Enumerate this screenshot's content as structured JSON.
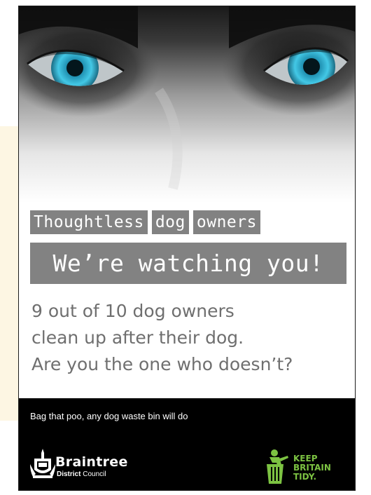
{
  "poster": {
    "tagline_words": [
      "Thoughtless",
      "dog",
      "owners"
    ],
    "headline": "We’re watching you!",
    "stat_lines": [
      "9 out of 10 dog owners",
      "clean up after their dog.",
      "Are you the one who doesn’t?"
    ],
    "footer_slogan": "Bag that poo, any dog waste bin will do"
  },
  "logos": {
    "council_name": "Braintree",
    "council_sub_bold": "District",
    "council_sub_rest": " Council",
    "kbt_lines": [
      "KEEP",
      "BRITAIN",
      "TIDY."
    ]
  },
  "colors": {
    "banner_gray": "#828282",
    "text_gray": "#6f6f6f",
    "eye_blue": "#3cc4e0",
    "kbt_green": "#7cc242",
    "footer_black": "#000000"
  },
  "icons": [
    "eyes-photo",
    "council-crest-icon",
    "litter-bin-figure-icon"
  ]
}
